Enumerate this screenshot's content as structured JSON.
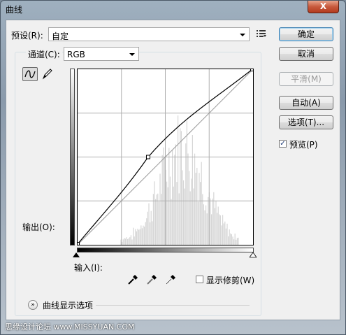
{
  "dialog": {
    "title": "曲线",
    "close_label": "X"
  },
  "preset": {
    "label": "预设(R):",
    "value": "自定"
  },
  "channel": {
    "label": "通道(C):",
    "value": "RGB"
  },
  "buttons": {
    "ok": "确定",
    "cancel": "取消",
    "smooth": "平滑(M)",
    "auto": "自动(A)",
    "options": "选项(T)..."
  },
  "preview": {
    "label": "预览(P)",
    "checked": true
  },
  "output_label": "输出(O):",
  "input_label": "输入(I):",
  "show_clipping": {
    "label": "显示修剪(W)",
    "checked": false
  },
  "curve_display_options": "曲线显示选项",
  "icons": {
    "presets_menu": "preset-options-icon",
    "curve_tool": "curve-point-icon",
    "pencil_tool": "pencil-icon",
    "eyedroppers": [
      "black-eyedropper-icon",
      "gray-eyedropper-icon",
      "white-eyedropper-icon"
    ],
    "expand": "chevron-double-down-icon"
  },
  "curve": {
    "control_points": [
      [
        0,
        0
      ],
      [
        103,
        127
      ],
      [
        255,
        255
      ]
    ]
  },
  "watermark": "思缘设计论坛 www.MISSYUAN.COM"
}
